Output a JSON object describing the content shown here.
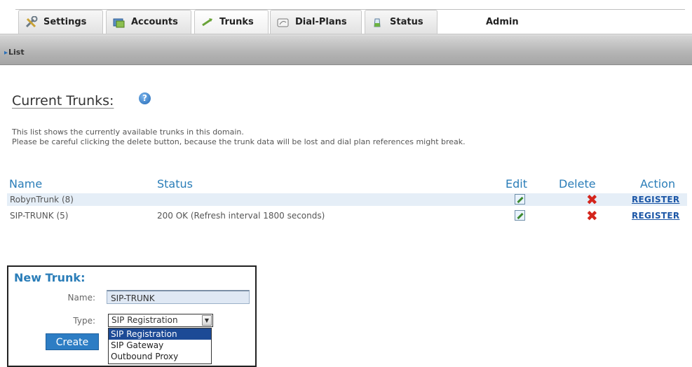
{
  "tabs": [
    {
      "label": "Settings",
      "icon": "tools-icon"
    },
    {
      "label": "Accounts",
      "icon": "accounts-icon"
    },
    {
      "label": "Trunks",
      "icon": "trunks-icon"
    },
    {
      "label": "Dial-Plans",
      "icon": "dialplans-icon"
    },
    {
      "label": "Status",
      "icon": "status-icon"
    }
  ],
  "admin_label": "Admin",
  "subnav": {
    "list_label": "List"
  },
  "heading": "Current Trunks:",
  "help_symbol": "?",
  "description": {
    "line1": "This list shows the currently available trunks in this domain.",
    "line2": "Please be careful clicking the delete button, because the trunk data will be lost and dial plan references might break."
  },
  "table": {
    "columns": {
      "name": "Name",
      "status": "Status",
      "edit": "Edit",
      "delete": "Delete",
      "action": "Action"
    },
    "rows": [
      {
        "name": "RobynTrunk (8)",
        "status": "",
        "action": "REGISTER"
      },
      {
        "name": "SIP-TRUNK (5)",
        "status": "200 OK (Refresh interval 1800 seconds)",
        "action": "REGISTER"
      }
    ]
  },
  "new_trunk": {
    "title": "New Trunk:",
    "name_label": "Name:",
    "name_value": "SIP-TRUNK",
    "type_label": "Type:",
    "type_value": "SIP Registration",
    "type_options": [
      "SIP Registration",
      "SIP Gateway",
      "Outbound Proxy"
    ],
    "create_label": "Create"
  },
  "colors": {
    "accent": "#2a7db8",
    "delete": "#d4251c",
    "link": "#1b56a6",
    "row_highlight": "#e5eef7"
  }
}
